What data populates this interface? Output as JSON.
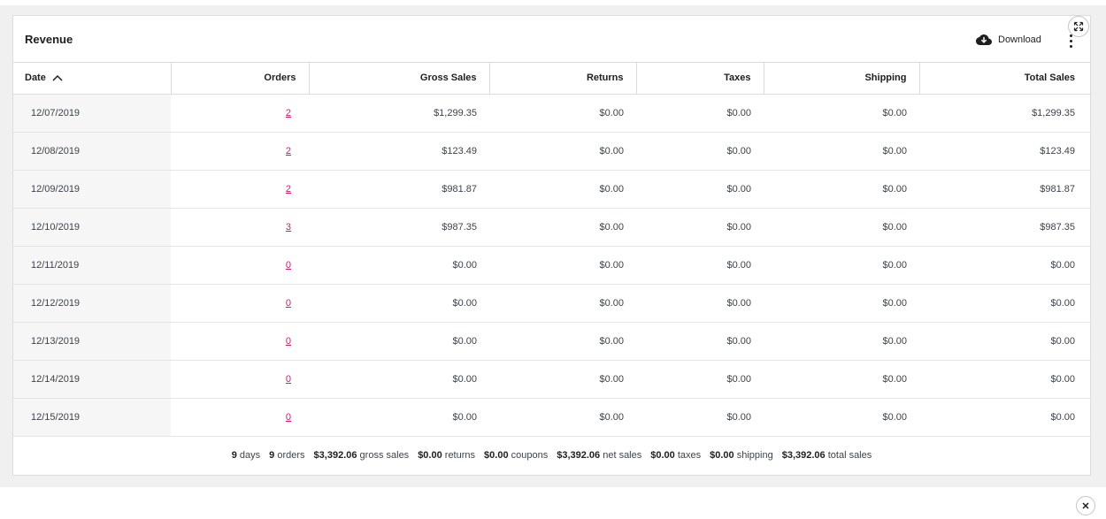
{
  "card": {
    "title": "Revenue",
    "download_label": "Download"
  },
  "table": {
    "columns": [
      "Date",
      "Orders",
      "Gross Sales",
      "Returns",
      "Taxes",
      "Shipping",
      "Total Sales"
    ],
    "sort": {
      "column": "Date",
      "direction": "ascending"
    },
    "rows": [
      {
        "date": "12/07/2019",
        "orders": "2",
        "gross_sales": "$1,299.35",
        "returns": "$0.00",
        "taxes": "$0.00",
        "shipping": "$0.00",
        "total_sales": "$1,299.35"
      },
      {
        "date": "12/08/2019",
        "orders": "2",
        "gross_sales": "$123.49",
        "returns": "$0.00",
        "taxes": "$0.00",
        "shipping": "$0.00",
        "total_sales": "$123.49"
      },
      {
        "date": "12/09/2019",
        "orders": "2",
        "gross_sales": "$981.87",
        "returns": "$0.00",
        "taxes": "$0.00",
        "shipping": "$0.00",
        "total_sales": "$981.87"
      },
      {
        "date": "12/10/2019",
        "orders": "3",
        "gross_sales": "$987.35",
        "returns": "$0.00",
        "taxes": "$0.00",
        "shipping": "$0.00",
        "total_sales": "$987.35"
      },
      {
        "date": "12/11/2019",
        "orders": "0",
        "gross_sales": "$0.00",
        "returns": "$0.00",
        "taxes": "$0.00",
        "shipping": "$0.00",
        "total_sales": "$0.00"
      },
      {
        "date": "12/12/2019",
        "orders": "0",
        "gross_sales": "$0.00",
        "returns": "$0.00",
        "taxes": "$0.00",
        "shipping": "$0.00",
        "total_sales": "$0.00"
      },
      {
        "date": "12/13/2019",
        "orders": "0",
        "gross_sales": "$0.00",
        "returns": "$0.00",
        "taxes": "$0.00",
        "shipping": "$0.00",
        "total_sales": "$0.00"
      },
      {
        "date": "12/14/2019",
        "orders": "0",
        "gross_sales": "$0.00",
        "returns": "$0.00",
        "taxes": "$0.00",
        "shipping": "$0.00",
        "total_sales": "$0.00"
      },
      {
        "date": "12/15/2019",
        "orders": "0",
        "gross_sales": "$0.00",
        "returns": "$0.00",
        "taxes": "$0.00",
        "shipping": "$0.00",
        "total_sales": "$0.00"
      }
    ]
  },
  "summary": [
    {
      "value": "9",
      "label": "days"
    },
    {
      "value": "9",
      "label": "orders"
    },
    {
      "value": "$3,392.06",
      "label": "gross sales"
    },
    {
      "value": "$0.00",
      "label": "returns"
    },
    {
      "value": "$0.00",
      "label": "coupons"
    },
    {
      "value": "$3,392.06",
      "label": "net sales"
    },
    {
      "value": "$0.00",
      "label": "taxes"
    },
    {
      "value": "$0.00",
      "label": "shipping"
    },
    {
      "value": "$3,392.06",
      "label": "total sales"
    }
  ],
  "colors": {
    "link": "#cc1d6f",
    "border": "#dcdcde",
    "date_column_bg": "#f6f6f6"
  },
  "icons": {
    "download": "cloud-download-icon",
    "more": "vertical-ellipsis-icon",
    "expand": "expand-arrows-icon",
    "close": "close-icon",
    "sort": "chevron-up-icon"
  }
}
